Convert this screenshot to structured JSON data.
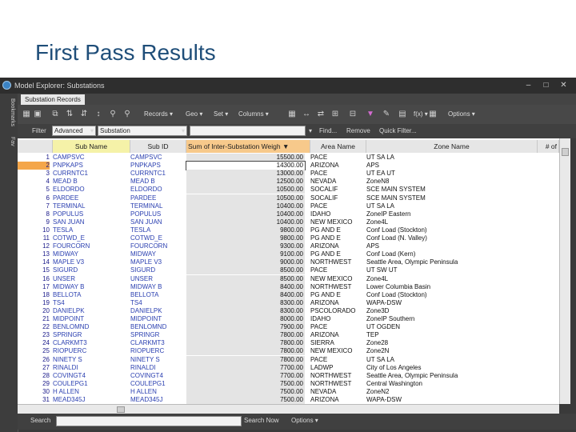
{
  "slide": {
    "title": "First Pass Results"
  },
  "window": {
    "title": "Model Explorer: Substations",
    "side_tabs": [
      "Bookmarks",
      "Fav"
    ],
    "tab": "Substation Records"
  },
  "toolbar": {
    "records": "Records",
    "geo": "Geo",
    "set": "Set",
    "columns": "Columns",
    "fx": "f(x)",
    "options": "Options"
  },
  "filter": {
    "label": "Filter",
    "mode": "Advanced",
    "field": "Substation",
    "value": "",
    "find": "Find...",
    "remove": "Remove",
    "quick": "Quick Filter..."
  },
  "columns": [
    "Sub Name",
    "Sub ID",
    "Sum of Inter-Substation Weigh",
    "Area Name",
    "Zone Name",
    "# of"
  ],
  "rows": [
    [
      "1",
      "CAMPSVC",
      "CAMPSVC",
      "15500.00",
      "PACE",
      "UT SA LA"
    ],
    [
      "2",
      "PNPKAPS",
      "PNPKAPS",
      "14300.00",
      "ARIZONA",
      "APS"
    ],
    [
      "3",
      "CURRNTC1",
      "CURRNTC1",
      "13000.00",
      "PACE",
      "UT EA UT"
    ],
    [
      "4",
      "MEAD B",
      "MEAD B",
      "12500.00",
      "NEVADA",
      "ZoneN8"
    ],
    [
      "5",
      "ELDORDO",
      "ELDORDO",
      "10500.00",
      "SOCALIF",
      "SCE MAIN SYSTEM"
    ],
    [
      "6",
      "PARDEE",
      "PARDEE",
      "10500.00",
      "SOCALIF",
      "SCE MAIN SYSTEM"
    ],
    [
      "7",
      "TERMINAL",
      "TERMINAL",
      "10400.00",
      "PACE",
      "UT SA LA"
    ],
    [
      "8",
      "POPULUS",
      "POPULUS",
      "10400.00",
      "IDAHO",
      "ZoneIP Eastern"
    ],
    [
      "9",
      "SAN JUAN",
      "SAN JUAN",
      "10400.00",
      "NEW MEXICO",
      "Zone4L"
    ],
    [
      "10",
      "TESLA",
      "TESLA",
      "9800.00",
      "PG AND E",
      "Conf Load (Stockton)"
    ],
    [
      "11",
      "COTWD_E",
      "COTWD_E",
      "9800.00",
      "PG AND E",
      "Conf Load (N. Valley)"
    ],
    [
      "12",
      "FOURCORN",
      "FOURCORN",
      "9300.00",
      "ARIZONA",
      "APS"
    ],
    [
      "13",
      "MIDWAY",
      "MIDWAY",
      "9100.00",
      "PG AND E",
      "Conf Load (Kern)"
    ],
    [
      "14",
      "MAPLE V3",
      "MAPLE V3",
      "9000.00",
      "NORTHWEST",
      "Seattle Area, Olympic Peninsula"
    ],
    [
      "15",
      "SIGURD",
      "SIGURD",
      "8500.00",
      "PACE",
      "UT SW UT"
    ],
    [
      "16",
      "UNSER",
      "UNSER",
      "8500.00",
      "NEW MEXICO",
      "Zone4L"
    ],
    [
      "17",
      "MIDWAY B",
      "MIDWAY B",
      "8400.00",
      "NORTHWEST",
      "Lower Columbia Basin"
    ],
    [
      "18",
      "BELLOTA",
      "BELLOTA",
      "8400.00",
      "PG AND E",
      "Conf Load (Stockton)"
    ],
    [
      "19",
      "TS4",
      "TS4",
      "8300.00",
      "ARIZONA",
      "WAPA-DSW"
    ],
    [
      "20",
      "DANIELPK",
      "DANIELPK",
      "8300.00",
      "PSCOLORADO",
      "Zone3D"
    ],
    [
      "21",
      "MIDPOINT",
      "MIDPOINT",
      "8000.00",
      "IDAHO",
      "ZoneIP Southern"
    ],
    [
      "22",
      "BENLOMND",
      "BENLOMND",
      "7900.00",
      "PACE",
      "UT OGDEN"
    ],
    [
      "23",
      "SPRINGR",
      "SPRINGR",
      "7800.00",
      "ARIZONA",
      "TEP"
    ],
    [
      "24",
      "CLARKMT3",
      "CLARKMT3",
      "7800.00",
      "SIERRA",
      "Zone28"
    ],
    [
      "25",
      "RIOPUERC",
      "RIOPUERC",
      "7800.00",
      "NEW MEXICO",
      "Zone2N"
    ],
    [
      "26",
      "NINETY S",
      "NINETY S",
      "7800.00",
      "PACE",
      "UT SA LA"
    ],
    [
      "27",
      "RINALDI",
      "RINALDI",
      "7700.00",
      "LADWP",
      "City of Los Angeles"
    ],
    [
      "28",
      "COVINGT4",
      "COVINGT4",
      "7700.00",
      "NORTHWEST",
      "Seattle Area, Olympic Peninsula"
    ],
    [
      "29",
      "COULEPG1",
      "COULEPG1",
      "7500.00",
      "NORTHWEST",
      "Central Washington"
    ],
    [
      "30",
      "H ALLEN",
      "H ALLEN",
      "7500.00",
      "NEVADA",
      "ZoneN2"
    ],
    [
      "31",
      "MEAD345J",
      "MEAD345J",
      "7500.00",
      "ARIZONA",
      "WAPA-DSW"
    ]
  ],
  "search": {
    "label": "Search",
    "value": "",
    "search_now": "Search Now",
    "options": "Options"
  }
}
